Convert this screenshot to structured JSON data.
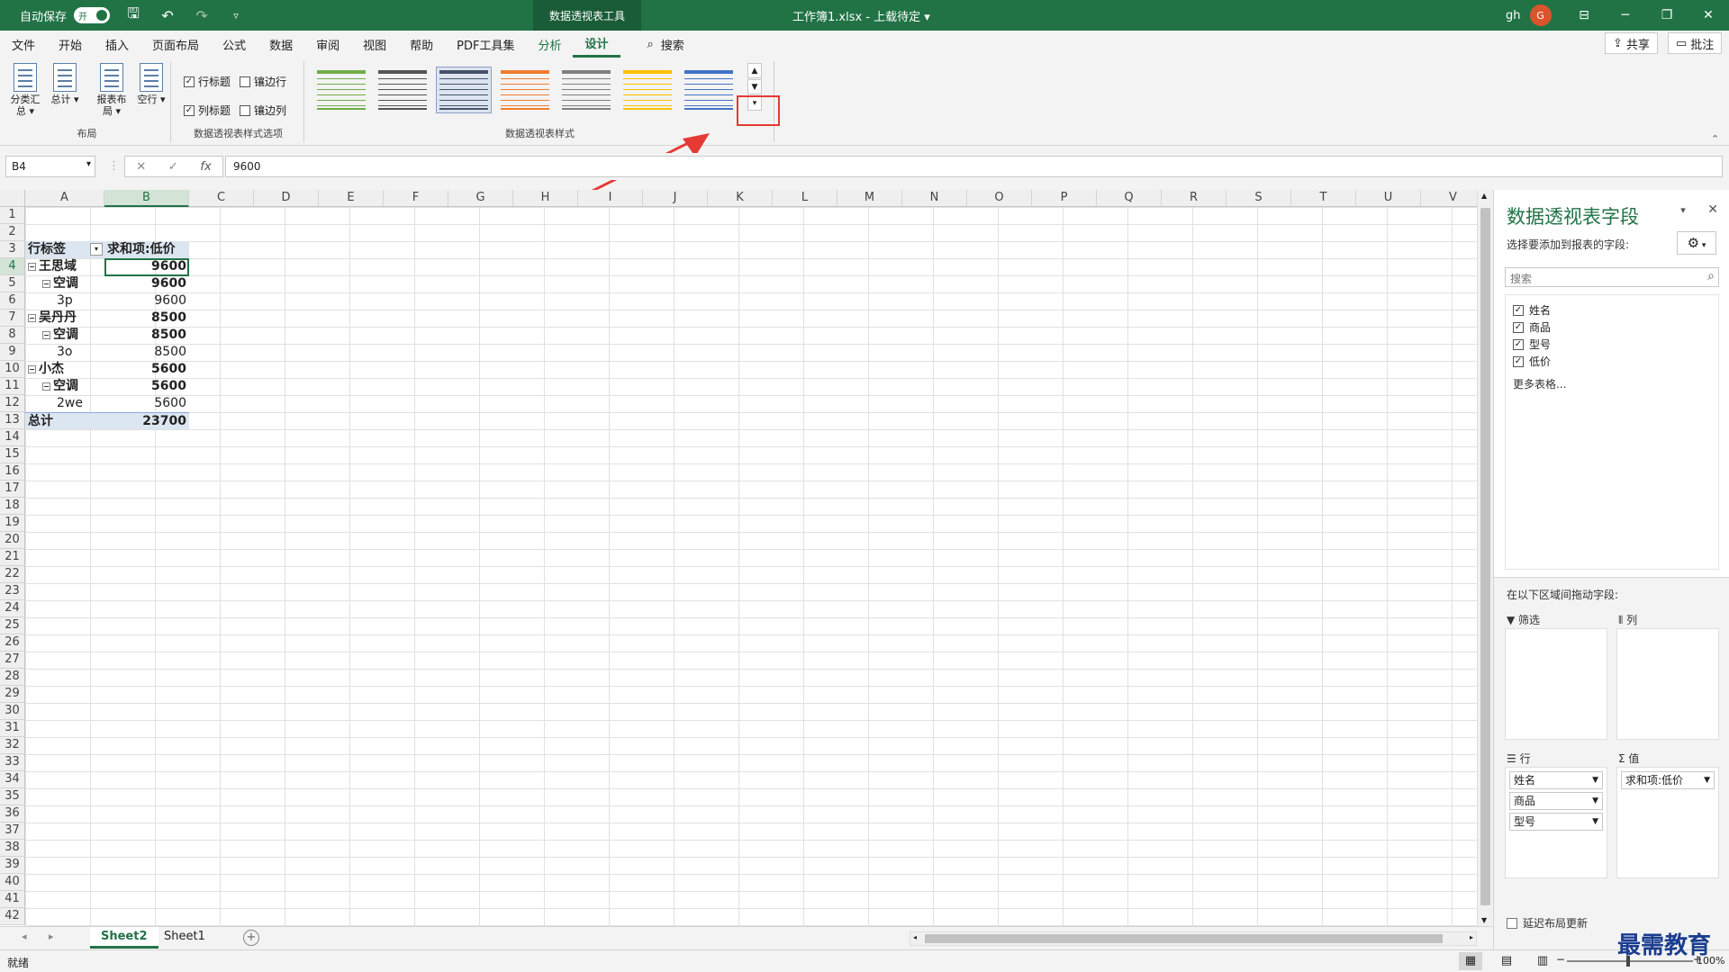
{
  "titlebar": {
    "autosave_label": "自动保存",
    "autosave_state": "开",
    "contextual_tab": "数据透视表工具",
    "document_title": "工作簿1.xlsx - 上载待定 ▾",
    "user_name": "gh",
    "avatar_initial": "G"
  },
  "tabs": [
    "文件",
    "开始",
    "插入",
    "页面布局",
    "公式",
    "数据",
    "审阅",
    "视图",
    "帮助",
    "PDF工具集",
    "分析",
    "设计"
  ],
  "active_tab": "设计",
  "search_label": "搜索",
  "share_label": "共享",
  "comments_label": "批注",
  "ribbon": {
    "layout_group": {
      "label": "布局",
      "subtotals": "分类汇总",
      "grand_totals": "总计",
      "report_layout": "报表布局",
      "blank_rows": "空行"
    },
    "style_options_group": {
      "label": "数据透视表样式选项",
      "row_headers": "行标题",
      "col_headers": "列标题",
      "banded_rows": "镶边行",
      "banded_cols": "镶边列"
    },
    "styles_group": {
      "label": "数据透视表样式"
    }
  },
  "formula_bar": {
    "name_box": "B4",
    "fx": "fx",
    "value": "9600"
  },
  "columns": [
    "A",
    "B",
    "C",
    "D",
    "E",
    "F",
    "G",
    "H",
    "I",
    "J",
    "K",
    "L",
    "M",
    "N",
    "O",
    "P",
    "Q",
    "R",
    "S",
    "T",
    "U",
    "V"
  ],
  "rows": [
    "1",
    "2",
    "3",
    "4",
    "5",
    "6",
    "7",
    "8",
    "9",
    "10",
    "11",
    "12",
    "13",
    "14",
    "15",
    "16",
    "17",
    "18",
    "19",
    "20",
    "21",
    "22",
    "23",
    "24",
    "25",
    "26",
    "27",
    "28",
    "29",
    "30",
    "31",
    "32",
    "33",
    "34",
    "35",
    "36",
    "37",
    "38",
    "39",
    "40",
    "41",
    "42"
  ],
  "pivot": {
    "header_label": "行标签",
    "header_value": "求和项:低价",
    "rows": [
      {
        "label": "王思域",
        "value": "9600",
        "level": 0
      },
      {
        "label": "空调",
        "value": "9600",
        "level": 1
      },
      {
        "label": "3p",
        "value": "9600",
        "level": 2
      },
      {
        "label": "吴丹丹",
        "value": "8500",
        "level": 0
      },
      {
        "label": "空调",
        "value": "8500",
        "level": 1
      },
      {
        "label": "3o",
        "value": "8500",
        "level": 2
      },
      {
        "label": "小杰",
        "value": "5600",
        "level": 0
      },
      {
        "label": "空调",
        "value": "5600",
        "level": 1
      },
      {
        "label": "2we",
        "value": "5600",
        "level": 2
      }
    ],
    "total_label": "总计",
    "total_value": "23700"
  },
  "sheets": [
    "Sheet2",
    "Sheet1"
  ],
  "active_sheet": "Sheet2",
  "status": {
    "ready": "就绪",
    "zoom": "100%"
  },
  "pane": {
    "title": "数据透视表字段",
    "subtitle": "选择要添加到报表的字段:",
    "search_placeholder": "搜索",
    "fields": [
      "姓名",
      "商品",
      "型号",
      "低价"
    ],
    "more_tables": "更多表格...",
    "drag_tip": "在以下区域间拖动字段:",
    "filters_label": "筛选",
    "columns_label": "列",
    "rows_label": "行",
    "values_label": "值",
    "row_fields": [
      "姓名",
      "商品",
      "型号"
    ],
    "value_fields": [
      "求和项:低价"
    ],
    "defer_label": "延迟布局更新"
  },
  "watermark": "最需教育",
  "colors": {
    "excel_green": "#217346",
    "pivot_header": "#dce6f1",
    "highlight_red": "#e53935"
  }
}
